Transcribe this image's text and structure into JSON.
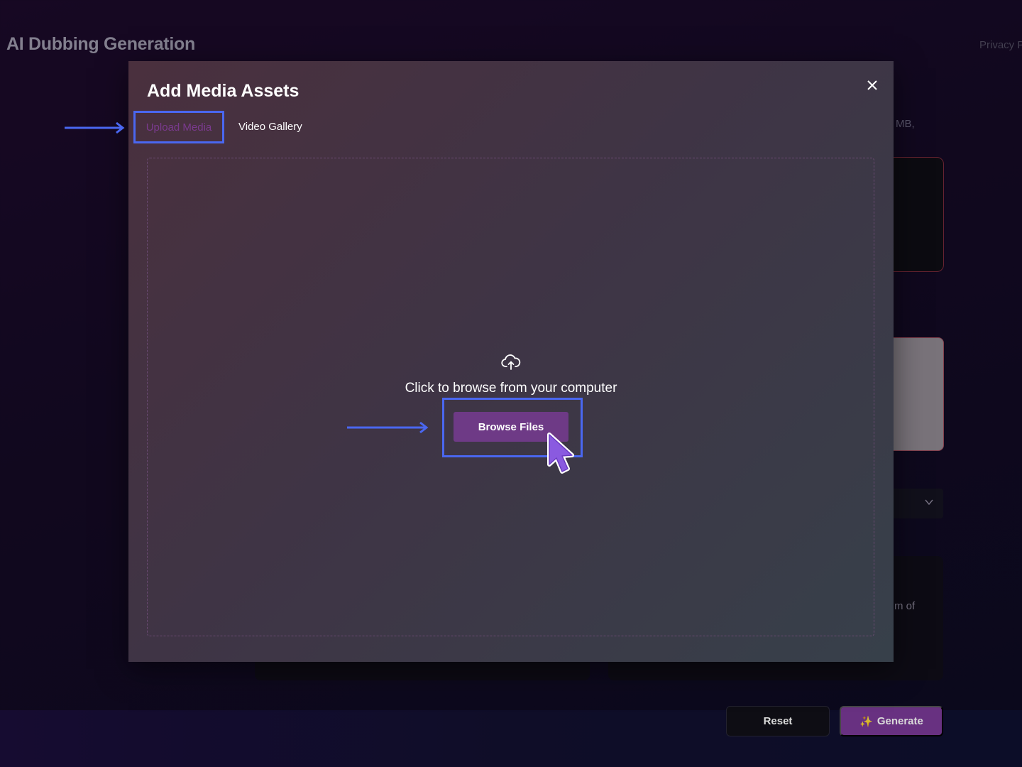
{
  "page": {
    "title": "AI Dubbing Generation",
    "privacy_label": "Privacy P",
    "size_hint_fragment": "MB,",
    "text_fragment_of": "m of"
  },
  "footer": {
    "reset_label": "Reset",
    "generate_label": "Generate",
    "generate_icon": "sparkles-icon"
  },
  "modal": {
    "title": "Add Media Assets",
    "close_icon": "close-icon",
    "tabs": [
      {
        "label": "Upload Media",
        "active": true
      },
      {
        "label": "Video Gallery",
        "active": false
      }
    ],
    "dropzone": {
      "icon": "cloud-upload-icon",
      "text": "Click to browse from your computer",
      "button_label": "Browse Files"
    }
  },
  "colors": {
    "accent": "#7b3a98",
    "highlight": "#4a67f0",
    "active_tab_text": "#7a3a8e"
  }
}
